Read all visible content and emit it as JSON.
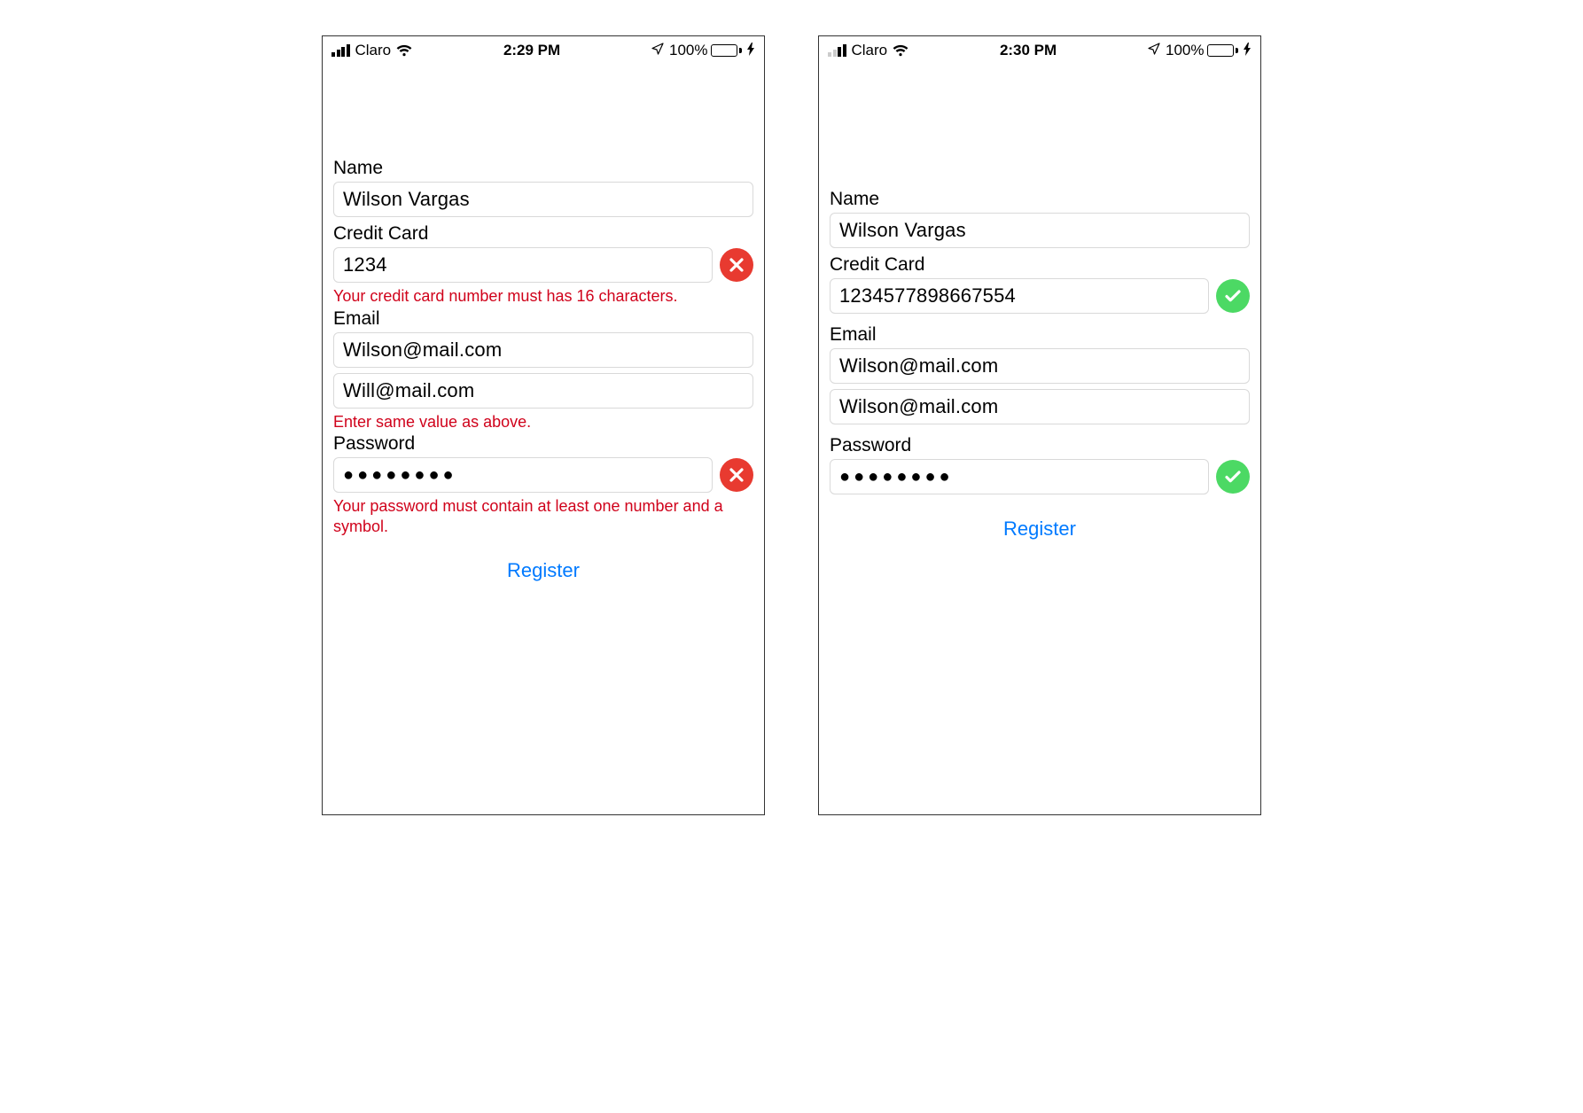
{
  "left": {
    "status": {
      "carrier": "Claro",
      "time": "2:29 PM",
      "battery": "100%"
    },
    "name_label": "Name",
    "name_value": "Wilson Vargas",
    "cc_label": "Credit Card",
    "cc_value": "1234",
    "cc_error": "Your credit card number must has 16 characters.",
    "email_label": "Email",
    "email_value": "Wilson@mail.com",
    "email2_value": "Will@mail.com",
    "email_error": "Enter same value as above.",
    "pw_label": "Password",
    "pw_value": "●●●●●●●●",
    "pw_error": "Your password must contain at least one number and a symbol.",
    "register": "Register"
  },
  "right": {
    "status": {
      "carrier": "Claro",
      "time": "2:30 PM",
      "battery": "100%"
    },
    "name_label": "Name",
    "name_value": "Wilson Vargas",
    "cc_label": "Credit Card",
    "cc_value": "1234577898667554",
    "email_label": "Email",
    "email_value": "Wilson@mail.com",
    "email2_value": "Wilson@mail.com",
    "pw_label": "Password",
    "pw_value": "●●●●●●●●",
    "register": "Register"
  }
}
